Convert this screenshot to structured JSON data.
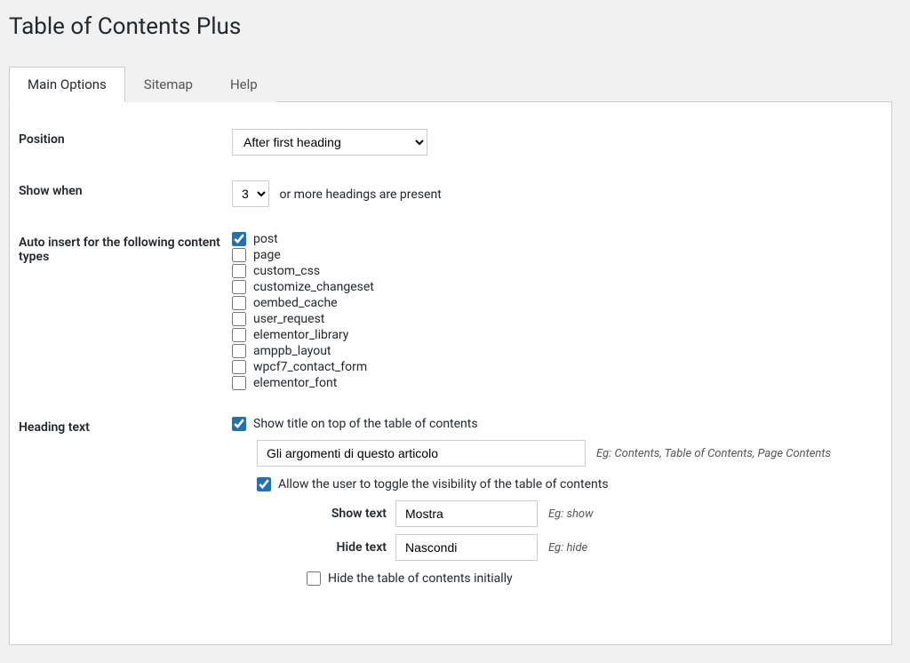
{
  "page_title": "Table of Contents Plus",
  "tabs": {
    "main": "Main Options",
    "sitemap": "Sitemap",
    "help": "Help"
  },
  "position": {
    "label": "Position",
    "value": "After first heading"
  },
  "show_when": {
    "label": "Show when",
    "value": "3",
    "suffix": "or more headings are present"
  },
  "auto_insert": {
    "label": "Auto insert for the following content types",
    "items": [
      {
        "label": "post",
        "checked": true
      },
      {
        "label": "page",
        "checked": false
      },
      {
        "label": "custom_css",
        "checked": false
      },
      {
        "label": "customize_changeset",
        "checked": false
      },
      {
        "label": "oembed_cache",
        "checked": false
      },
      {
        "label": "user_request",
        "checked": false
      },
      {
        "label": "elementor_library",
        "checked": false
      },
      {
        "label": "amppb_layout",
        "checked": false
      },
      {
        "label": "wpcf7_contact_form",
        "checked": false
      },
      {
        "label": "elementor_font",
        "checked": false
      }
    ]
  },
  "heading_text": {
    "label": "Heading text",
    "show_title": {
      "label": "Show title on top of the table of contents",
      "checked": true
    },
    "title_input": {
      "value": "Gli argomenti di questo articolo",
      "hint": "Eg: Contents, Table of Contents, Page Contents"
    },
    "allow_toggle": {
      "label": "Allow the user to toggle the visibility of the table of contents",
      "checked": true
    },
    "show_text": {
      "label": "Show text",
      "value": "Mostra",
      "hint": "Eg: show"
    },
    "hide_text": {
      "label": "Hide text",
      "value": "Nascondi",
      "hint": "Eg: hide"
    },
    "hide_initially": {
      "label": "Hide the table of contents initially",
      "checked": false
    }
  }
}
